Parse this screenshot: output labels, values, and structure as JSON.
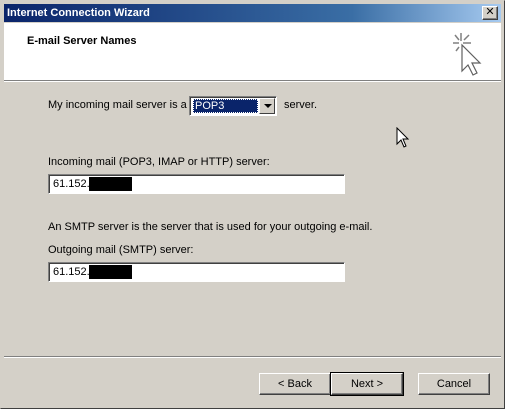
{
  "window": {
    "title": "Internet Connection Wizard",
    "close_label": "✕"
  },
  "header": {
    "title": "E-mail Server Names",
    "icon": "wizard-sparkle-cursor-icon"
  },
  "incoming_type": {
    "label_before": "My incoming mail server is a",
    "selected": "POP3",
    "label_after": "server."
  },
  "incoming_server": {
    "label": "Incoming mail (POP3, IMAP or HTTP) server:",
    "value": "61.152."
  },
  "smtp_note": "An SMTP server is the server that is used for your outgoing e-mail.",
  "outgoing_server": {
    "label": "Outgoing mail (SMTP) server:",
    "value": "61.152."
  },
  "buttons": {
    "back": "< Back",
    "next": "Next >",
    "cancel": "Cancel"
  },
  "colors": {
    "titlebar_start": "#0a246a",
    "titlebar_end": "#a6caf0",
    "dialog_face": "#d4d0c8",
    "selection": "#0a246a"
  }
}
